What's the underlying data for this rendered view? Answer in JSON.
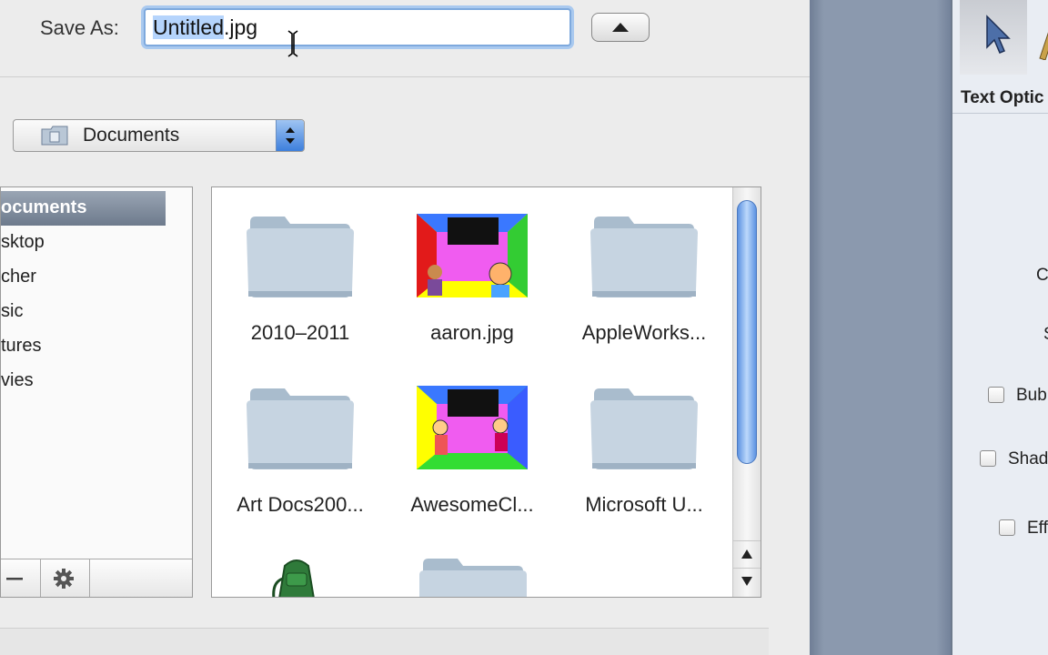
{
  "save_as": {
    "label": "Save As:",
    "filename_selected": "Untitled",
    "filename_rest": ".jpg"
  },
  "location": {
    "label": "Documents"
  },
  "sidebar": {
    "selected": "ocuments",
    "items": [
      "sktop",
      "cher",
      "sic",
      "tures",
      "vies"
    ]
  },
  "files": [
    {
      "name": "2010–2011",
      "kind": "folder"
    },
    {
      "name": "aaron.jpg",
      "kind": "image"
    },
    {
      "name": "AppleWorks...",
      "kind": "folder"
    },
    {
      "name": "Art Docs200...",
      "kind": "folder"
    },
    {
      "name": "AwesomeCl...",
      "kind": "image"
    },
    {
      "name": "Microsoft U...",
      "kind": "folder"
    }
  ],
  "right_panel": {
    "title": "Text Optic",
    "labels": [
      "C",
      "S"
    ],
    "checkboxes": [
      "Bub",
      "Shad",
      "Eff"
    ]
  },
  "colors": {
    "selection": "#b5d4fc",
    "accent_blue": "#3d7fdc",
    "folder": "#c6d3e0"
  }
}
